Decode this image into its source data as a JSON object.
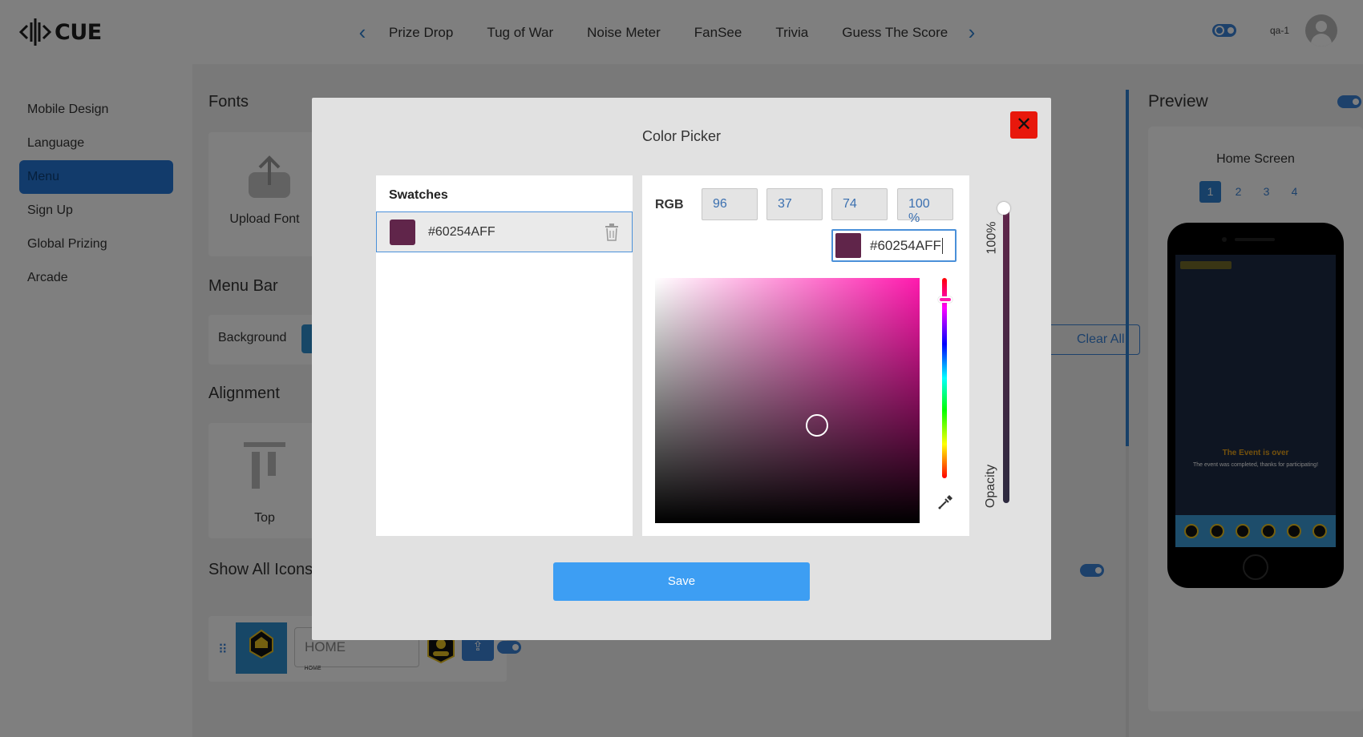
{
  "app": {
    "logo_text": "CUE"
  },
  "nav": {
    "tabs": [
      "Prize Drop",
      "Tug of War",
      "Noise Meter",
      "FanSee",
      "Trivia",
      "Guess The Score"
    ]
  },
  "header": {
    "user_name": "qa-1"
  },
  "sidebar": {
    "items": [
      {
        "label": "Mobile Design"
      },
      {
        "label": "Language"
      },
      {
        "label": "Menu",
        "active": true
      },
      {
        "label": "Sign Up"
      },
      {
        "label": "Global Prizing"
      },
      {
        "label": "Arcade"
      }
    ]
  },
  "content": {
    "fonts_title": "Fonts",
    "upload_font_label": "Upload Font",
    "menu_bar_title": "Menu Bar",
    "background_label": "Background",
    "alignment_title": "Alignment",
    "align_top_label": "Top",
    "show_all_icons_title": "Show All Icons",
    "clear_all_label": "Clear All",
    "home_thumb_label": "HOME",
    "home_input_value": "HOME"
  },
  "preview": {
    "title": "Preview",
    "screen_title": "Home Screen",
    "pages": [
      "1",
      "2",
      "3",
      "4"
    ],
    "active_page": "1",
    "event_title": "The Event is over",
    "event_text": "The event was completed, thanks for participating!"
  },
  "color_picker": {
    "title": "Color Picker",
    "close_symbol": "✕",
    "swatches_title": "Swatches",
    "swatches": [
      {
        "hex": "#60254AFF",
        "color": "#60254A"
      }
    ],
    "rgb_label": "RGB",
    "r": "96",
    "g": "37",
    "b": "74",
    "alpha": "100 %",
    "hex_value": "#60254AFF",
    "selected_color": "#60254A",
    "hue_color": "#FF1AAE",
    "opacity_value": "100%",
    "opacity_label": "Opacity",
    "save_label": "Save"
  },
  "colors": {
    "accent": "#2F80D0",
    "close_red": "#E8180C",
    "save_blue": "#3D9EF3"
  }
}
